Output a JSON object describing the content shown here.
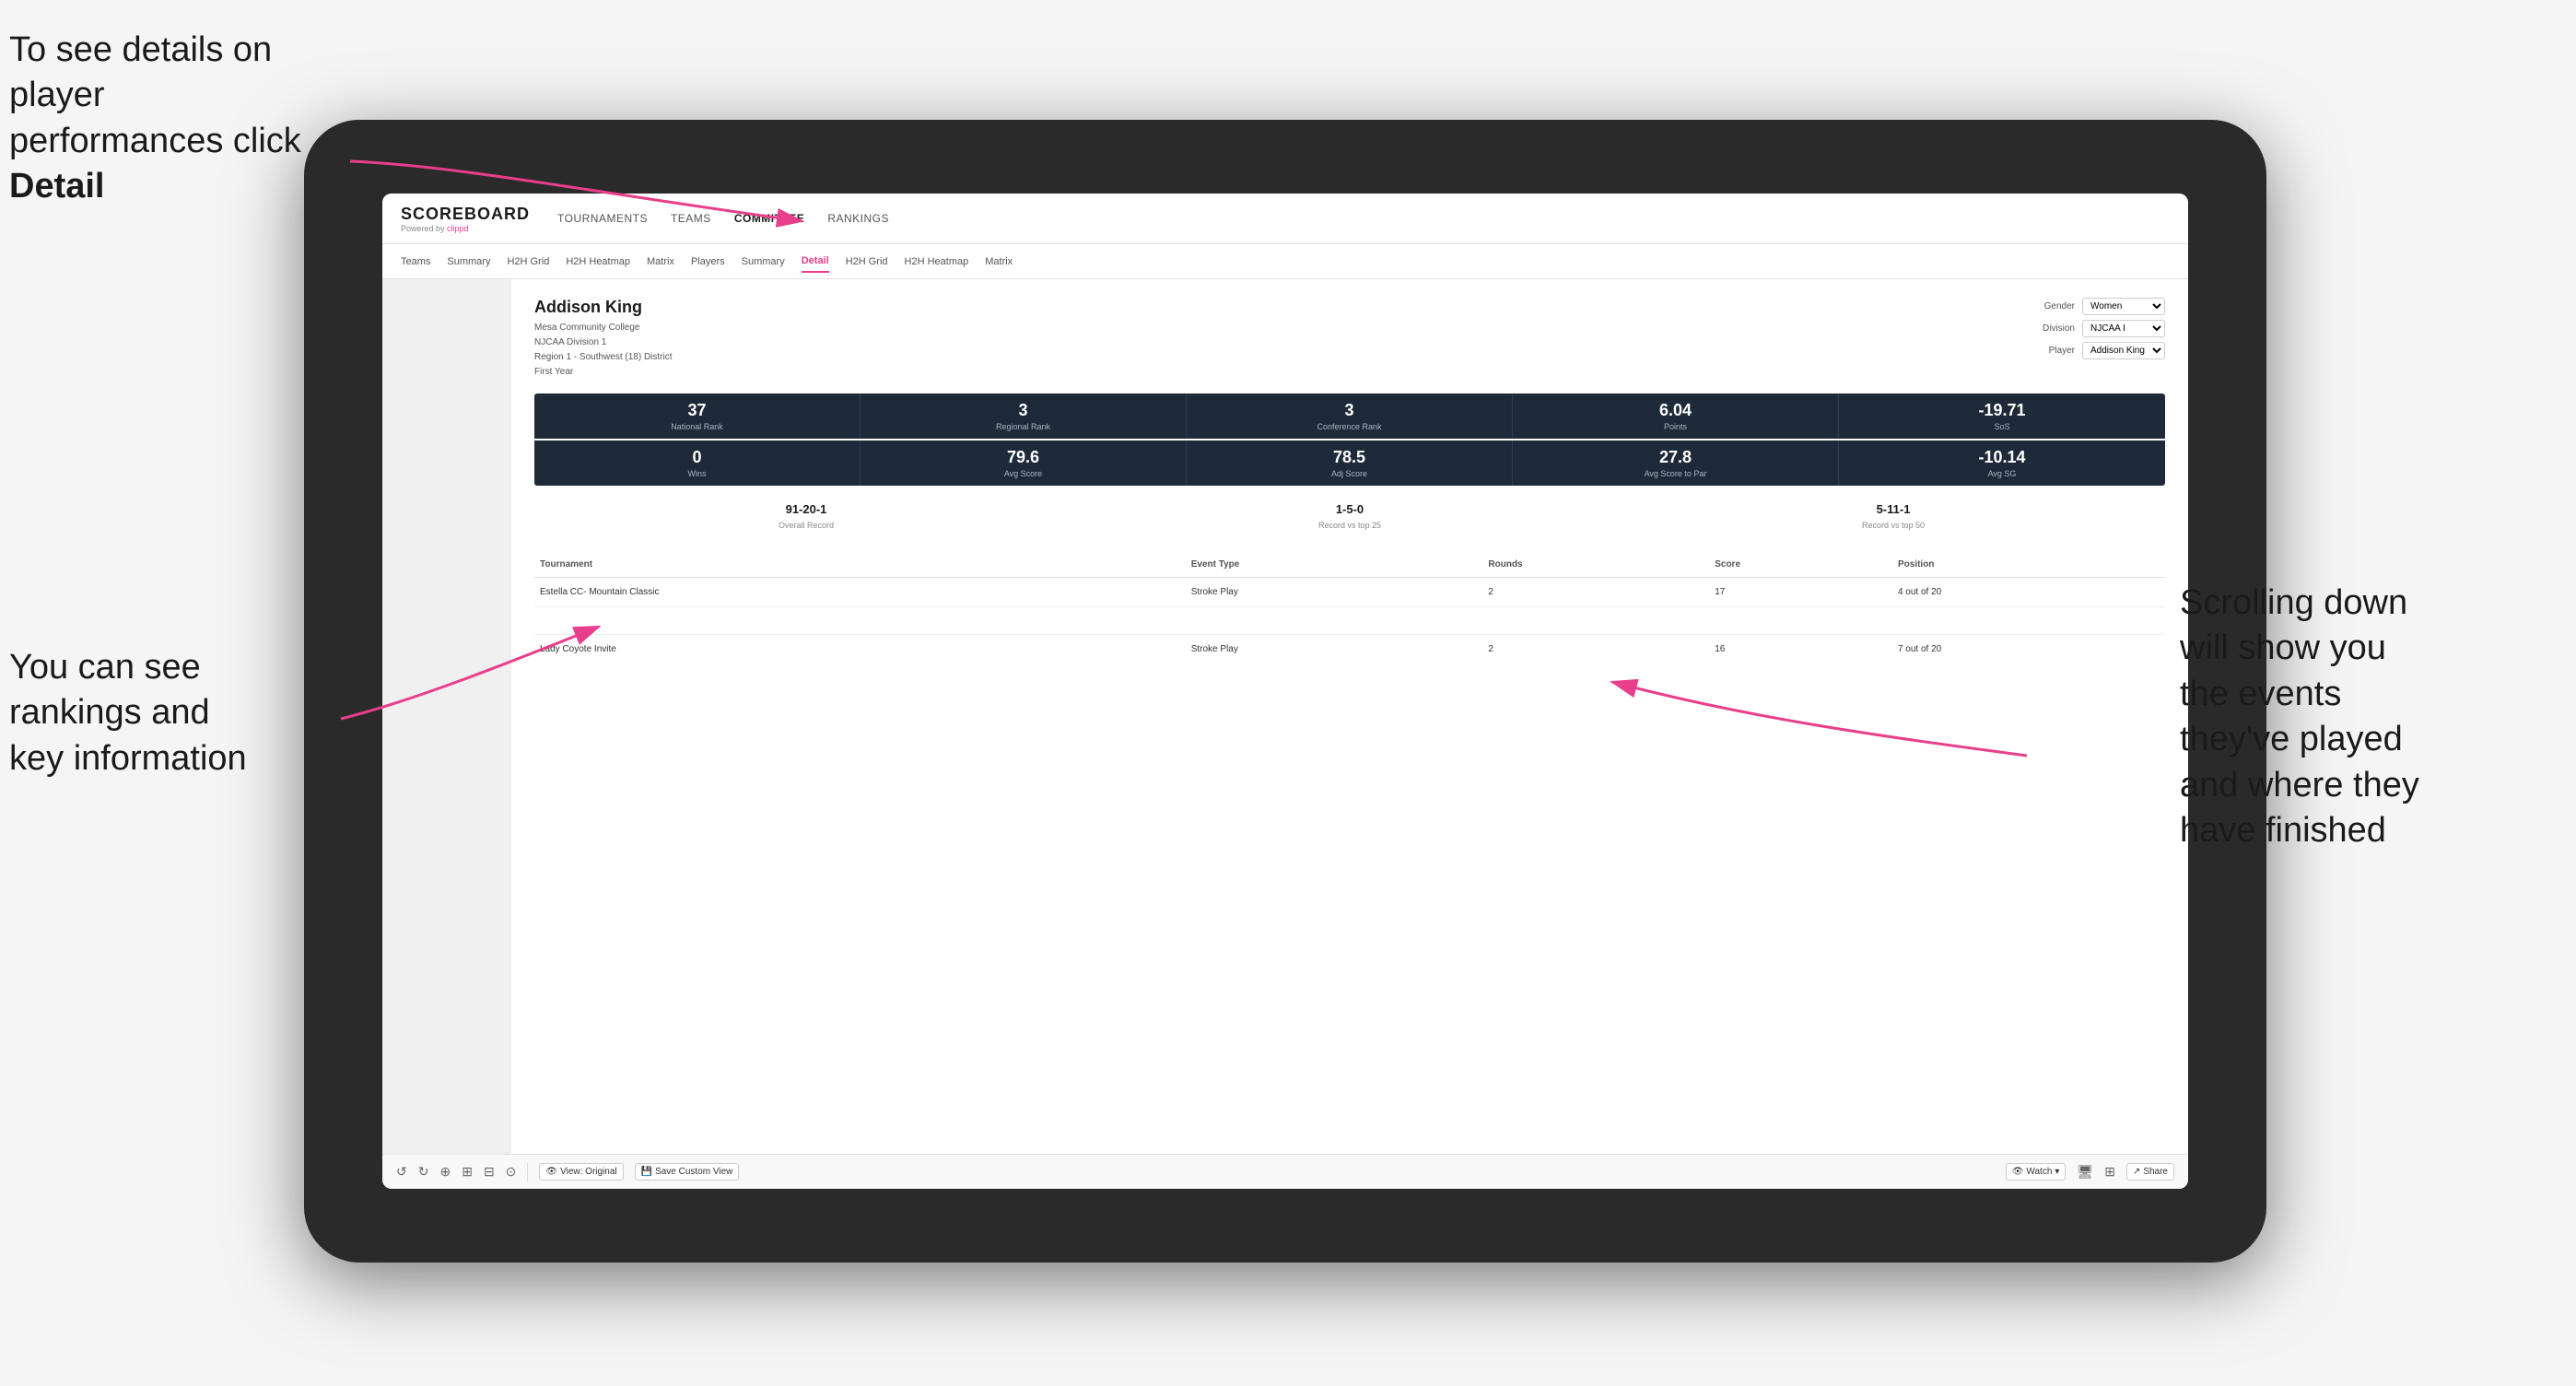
{
  "annotations": {
    "topleft": "To see details on player performances click",
    "topleft_bold": "Detail",
    "bottomleft_line1": "You can see",
    "bottomleft_line2": "rankings and",
    "bottomleft_line3": "key information",
    "bottomright_line1": "Scrolling down",
    "bottomright_line2": "will show you",
    "bottomright_line3": "the events",
    "bottomright_line4": "they've played",
    "bottomright_line5": "and where they",
    "bottomright_line6": "have finished"
  },
  "nav": {
    "logo": "SCOREBOARD",
    "powered_by": "Powered by",
    "clippd": "clippd",
    "items": [
      {
        "label": "TOURNAMENTS"
      },
      {
        "label": "TEAMS"
      },
      {
        "label": "COMMITTEE",
        "active": true
      },
      {
        "label": "RANKINGS"
      }
    ]
  },
  "subnav": {
    "items": [
      {
        "label": "Teams"
      },
      {
        "label": "Summary"
      },
      {
        "label": "H2H Grid"
      },
      {
        "label": "H2H Heatmap"
      },
      {
        "label": "Matrix"
      },
      {
        "label": "Players"
      },
      {
        "label": "Summary"
      },
      {
        "label": "Detail",
        "active": true
      },
      {
        "label": "H2H Grid"
      },
      {
        "label": "H2H Heatmap"
      },
      {
        "label": "Matrix"
      }
    ]
  },
  "player": {
    "name": "Addison King",
    "school": "Mesa Community College",
    "division": "NJCAA Division 1",
    "region": "Region 1 - Southwest (18) District",
    "year": "First Year"
  },
  "filters": {
    "gender_label": "Gender",
    "gender_value": "Women",
    "division_label": "Division",
    "division_value": "NJCAA I",
    "player_label": "Player",
    "player_value": "Addison King"
  },
  "stats_row1": [
    {
      "value": "37",
      "label": "National Rank"
    },
    {
      "value": "3",
      "label": "Regional Rank"
    },
    {
      "value": "3",
      "label": "Conference Rank"
    },
    {
      "value": "6.04",
      "label": "Points"
    },
    {
      "value": "-19.71",
      "label": "SoS"
    }
  ],
  "stats_row2": [
    {
      "value": "0",
      "label": "Wins"
    },
    {
      "value": "79.6",
      "label": "Avg Score"
    },
    {
      "value": "78.5",
      "label": "Adj Score"
    },
    {
      "value": "27.8",
      "label": "Avg Score to Par"
    },
    {
      "value": "-10.14",
      "label": "Avg SG"
    }
  ],
  "records": [
    {
      "value": "91-20-1",
      "label": "Overall Record"
    },
    {
      "value": "1-5-0",
      "label": "Record vs top 25"
    },
    {
      "value": "5-11-1",
      "label": "Record vs top 50"
    }
  ],
  "table": {
    "headers": [
      "Tournament",
      "Event Type",
      "Rounds",
      "Score",
      "Position"
    ],
    "rows": [
      {
        "tournament": "Estella CC- Mountain Classic",
        "event_type": "Stroke Play",
        "rounds": "2",
        "score": "17",
        "position": "4 out of 20"
      },
      {
        "tournament": "Lady Coyote Invite",
        "event_type": "Stroke Play",
        "rounds": "2",
        "score": "16",
        "position": "7 out of 20"
      }
    ]
  },
  "toolbar": {
    "undo": "↺",
    "redo": "↻",
    "view_original": "View: Original",
    "save_custom": "Save Custom View",
    "watch": "Watch",
    "share": "Share"
  }
}
